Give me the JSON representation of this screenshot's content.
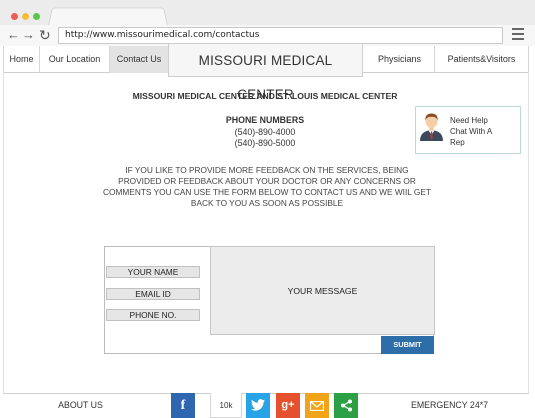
{
  "browser": {
    "url": "http://www.missourimedical.com/contactus",
    "back_icon": "back-arrow-icon",
    "forward_icon": "forward-arrow-icon",
    "reload_icon": "reload-icon",
    "menu_icon": "hamburger-menu-icon"
  },
  "nav": {
    "home": "Home",
    "our_location": "Our Location",
    "contact_us": "Contact Us",
    "brand": "MISSOURI MEDICAL CENTER",
    "physicians": "Physicians",
    "patients_visitors": "Patients&Visitors"
  },
  "main": {
    "centers_title": "MISSOURI MEDICAL CENTER AND ST. LOUIS MEDICAL CENTER",
    "phone_heading": "PHONE NUMBERS",
    "phones": [
      "(540)-890-4000",
      "(540)-890-5000"
    ],
    "notice": "IF YOU LIKE TO PROVIDE MORE FEEDBACK ON THE SERVICES, BEING PROVIDED OR FEEDBACK ABOUT YOUR DOCTOR OR ANY CONCERNS OR COMMENTS YOU CAN USE THE FORM BELOW TO CONTACT US AND WE WIIL GET BACK TO YOU AS SOON AS POSSIBLE"
  },
  "chat": {
    "line1": "Need Help",
    "line2": "Chat With A",
    "line3": "Rep",
    "avatar_icon": "support-rep-avatar-icon"
  },
  "form": {
    "name_label": "YOUR NAME",
    "email_label": "EMAIL ID",
    "phone_label": "PHONE NO.",
    "message_label": "YOUR MESSAGE",
    "submit_label": "SUBMIT"
  },
  "footer": {
    "about": "ABOUT US",
    "facebook_glyph": "f",
    "like_count": "10k",
    "googleplus_glyph": "g+",
    "emergency": "EMERGENCY 24*7",
    "icons": [
      "facebook-icon",
      "twitter-icon",
      "google-plus-icon",
      "mail-icon",
      "share-icon"
    ]
  },
  "colors": {
    "facebook": "#2f66b0",
    "twitter": "#28a3e8",
    "google_plus": "#e4512c",
    "mail": "#f2a419",
    "share": "#2ca044",
    "submit": "#2e6ea8"
  }
}
